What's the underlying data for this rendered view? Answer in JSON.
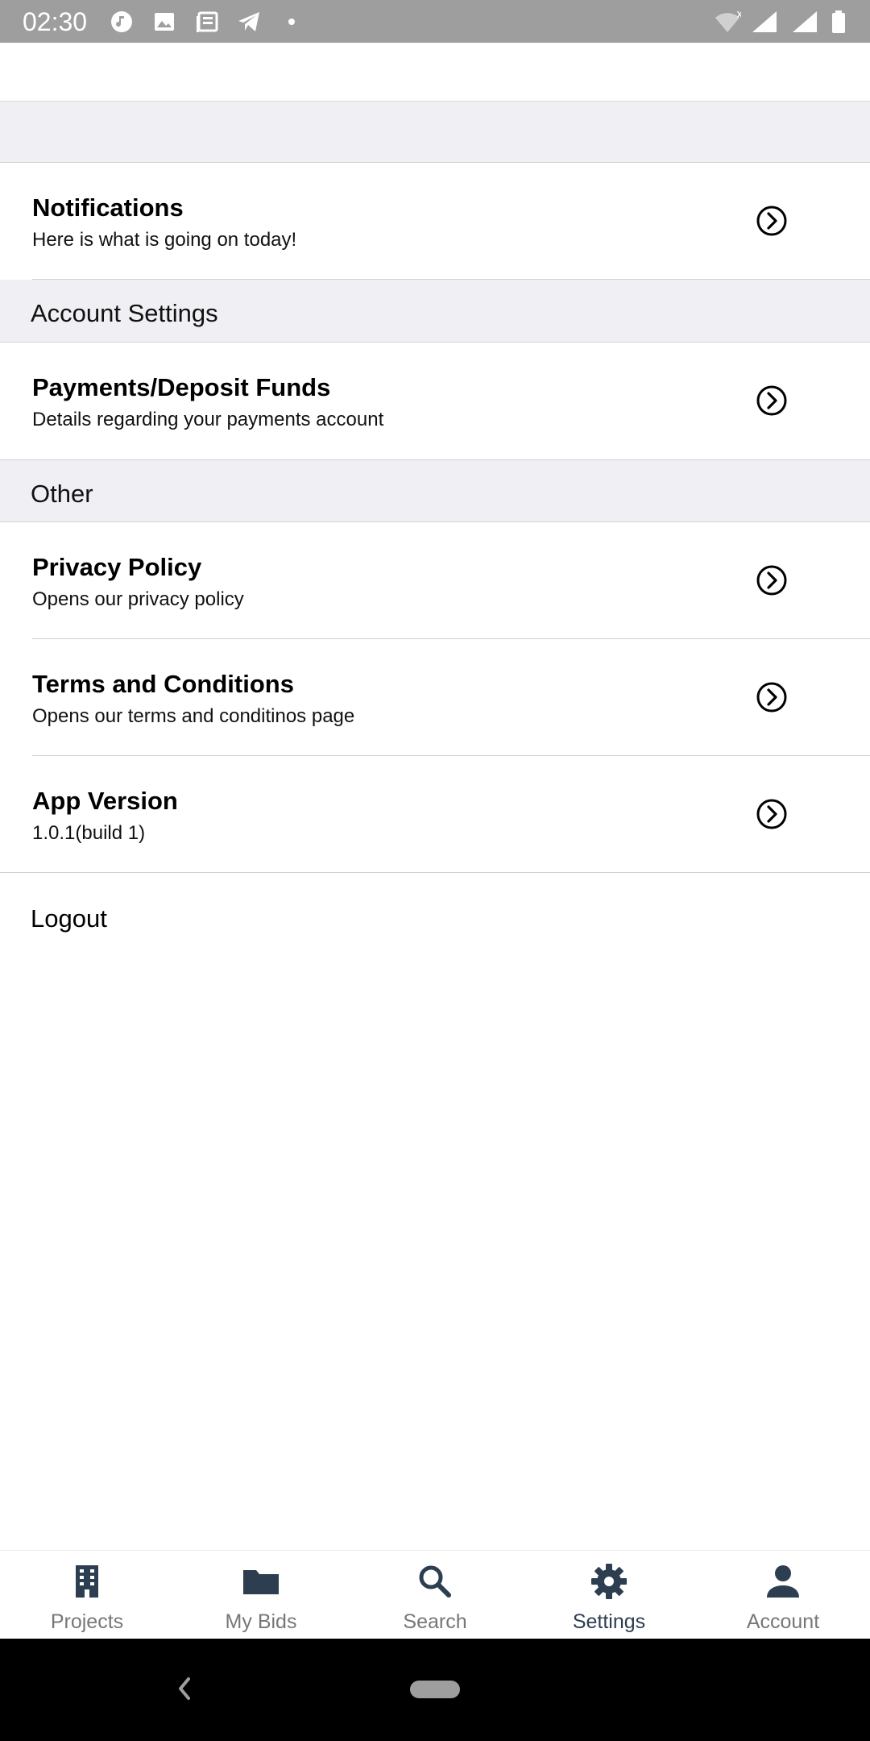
{
  "status_bar": {
    "time": "02:30",
    "left_icons": [
      "music-icon",
      "image-icon",
      "news-icon",
      "telegram-icon",
      "dot-icon"
    ],
    "right_icons": [
      "wifi-icon",
      "signal-icon",
      "signal-icon",
      "battery-icon"
    ]
  },
  "notifications": {
    "title": "Notifications",
    "subtitle": "Here is what is going on today!"
  },
  "sections": {
    "account_settings": "Account Settings",
    "other": "Other"
  },
  "payments": {
    "title": "Payments/Deposit Funds",
    "subtitle": "Details regarding your payments account"
  },
  "privacy": {
    "title": "Privacy Policy",
    "subtitle": "Opens our privacy policy"
  },
  "terms": {
    "title": "Terms and Conditions",
    "subtitle": "Opens our terms and conditinos page"
  },
  "app_version": {
    "title": "App Version",
    "subtitle": "1.0.1(build 1)"
  },
  "logout_label": "Logout",
  "bottom_nav": {
    "items": [
      {
        "label": "Projects",
        "icon": "building-icon"
      },
      {
        "label": "My Bids",
        "icon": "folder-icon"
      },
      {
        "label": "Search",
        "icon": "search-icon"
      },
      {
        "label": "Settings",
        "icon": "gear-icon"
      },
      {
        "label": "Account",
        "icon": "person-icon"
      }
    ],
    "active": "Settings",
    "active_color": "#2c3e50",
    "inactive_color": "#777777"
  }
}
